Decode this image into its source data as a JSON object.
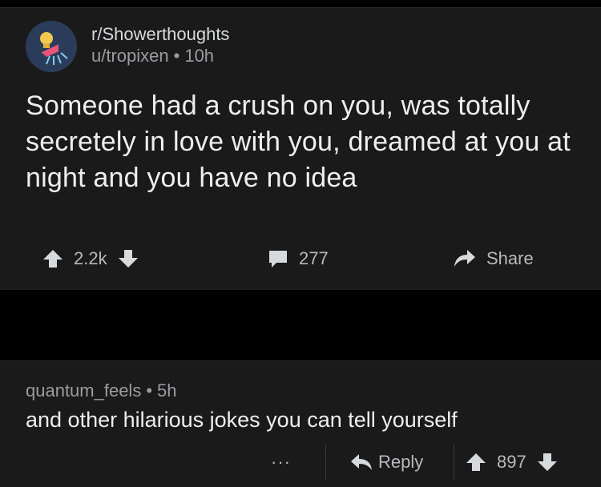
{
  "post": {
    "subreddit": "r/Showerthoughts",
    "username": "u/tropixen",
    "time": "10h",
    "title": "Someone had a crush on you, was totally secretely in love with you, dreamed at you at night and you have no idea",
    "votes": "2.2k",
    "comments": "277",
    "share_label": "Share"
  },
  "comment": {
    "username": "quantum_feels",
    "time": "5h",
    "body": "and other hilarious jokes you can tell yourself",
    "more_label": "···",
    "reply_label": "Reply",
    "votes": "897"
  },
  "separator": "•",
  "colors": {
    "background": "#000000",
    "card": "#1a1a1b",
    "text_primary": "#eeeeee",
    "text_secondary": "#9a9ca0",
    "icon": "#b7b9bc"
  },
  "icons": [
    "subreddit-avatar-icon",
    "upvote-icon",
    "downvote-icon",
    "comment-icon",
    "share-icon",
    "reply-icon"
  ]
}
